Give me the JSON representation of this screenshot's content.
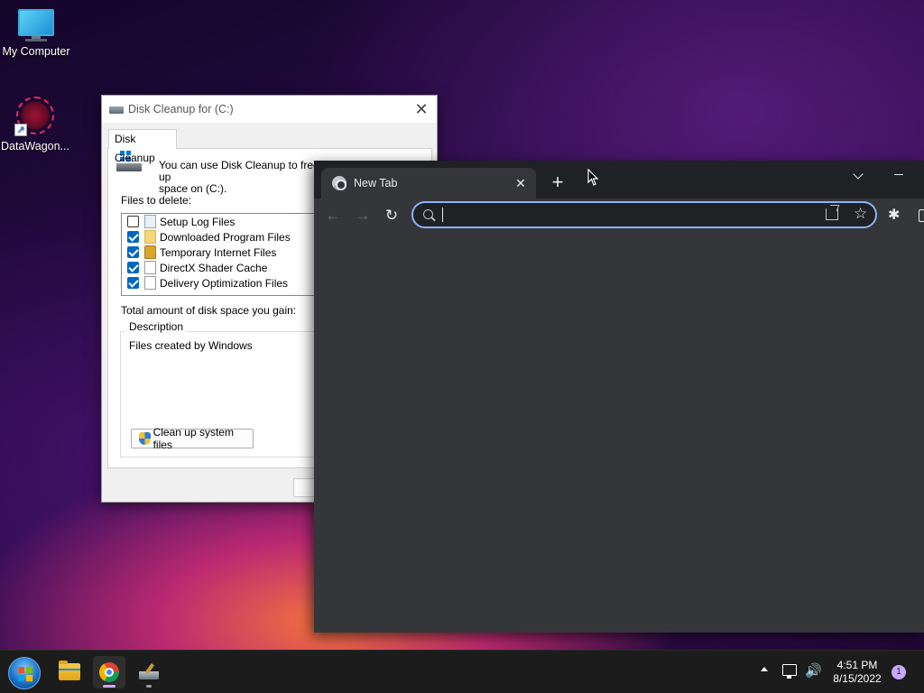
{
  "desktop": {
    "icons": [
      {
        "label": "My Computer",
        "icon": "monitor-icon"
      },
      {
        "label": "DataWagon...",
        "icon": "datawagon-logo-icon"
      }
    ]
  },
  "disk_cleanup": {
    "title": "Disk Cleanup for  (C:)",
    "tab": "Disk Cleanup",
    "intro": "You can use Disk Cleanup to free up",
    "intro_line2": "space on  (C:).",
    "files_label": "Files to delete:",
    "files": [
      {
        "name": "Setup Log Files",
        "checked": false
      },
      {
        "name": "Downloaded Program Files",
        "checked": true
      },
      {
        "name": "Temporary Internet Files",
        "checked": true
      },
      {
        "name": "DirectX Shader Cache",
        "checked": true
      },
      {
        "name": "Delivery Optimization Files",
        "checked": true
      }
    ],
    "total_label": "Total amount of disk space you gain:",
    "description_legend": "Description",
    "description_text": "Files created by Windows",
    "system_files_button": "Clean up system files"
  },
  "chrome": {
    "tab_title": "New Tab",
    "omnibox_value": "",
    "close_tab_glyph": "✕",
    "new_tab_glyph": "+",
    "back_glyph": "←",
    "forward_glyph": "→",
    "reload_glyph": "↻",
    "star_glyph": "☆",
    "extensions_glyph": "✱",
    "accent": "#8ab4f8",
    "bg": "#35363a"
  },
  "taskbar": {
    "apps": [
      "start-button",
      "file-explorer",
      "google-chrome",
      "disk-cleanup"
    ],
    "clock_time": "4:51 PM",
    "clock_date": "8/15/2022",
    "notification_count": "1",
    "volume_glyph": "🔊"
  }
}
